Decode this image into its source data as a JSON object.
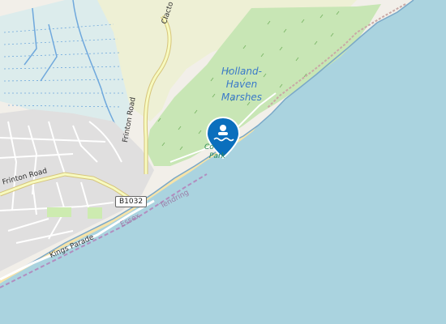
{
  "map": {
    "labels": {
      "marshes_line1": "Holland-",
      "marshes_line2": "Haven",
      "marshes_line3": "Marshes",
      "country_park_line1": "Co",
      "country_park_line2": "Park",
      "frinton_road_vertical": "Frinton Road",
      "frinton_road_horizontal": "Frinton Road",
      "clacton_road": "Clacto",
      "kings_parade": "Kings Parade",
      "route_badge": "B1032",
      "boundary_essex": "Essex",
      "boundary_tendring": "Tendring"
    },
    "marker": {
      "icon": "swimming-icon",
      "color": "#0b6fbd"
    },
    "colors": {
      "sea": "#aad3df",
      "marsh": "#c8e6b5",
      "farmland": "#eef0d5",
      "residential": "#e0dfdf",
      "beach": "#f6e3a8",
      "road_primary": "#f7fabf",
      "road_minor": "#ffffff"
    }
  }
}
